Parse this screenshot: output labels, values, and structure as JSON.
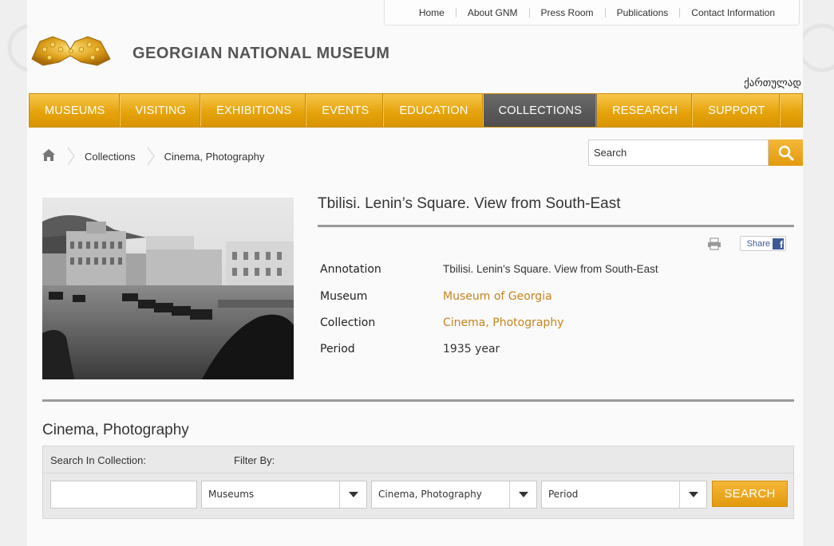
{
  "top_nav": [
    "Home",
    "About GNM",
    "Press Room",
    "Publications",
    "Contact Information"
  ],
  "site_title": "GEORGIAN NATIONAL MUSEUM",
  "language_link": "ქართულად",
  "main_nav": [
    {
      "label": "MUSEUMS",
      "active": false
    },
    {
      "label": "VISITING",
      "active": false
    },
    {
      "label": "EXHIBITIONS",
      "active": false
    },
    {
      "label": "EVENTS",
      "active": false
    },
    {
      "label": "EDUCATION",
      "active": false
    },
    {
      "label": "COLLECTIONS",
      "active": true
    },
    {
      "label": "RESEARCH",
      "active": false
    },
    {
      "label": "SUPPORT",
      "active": false
    }
  ],
  "breadcrumb": [
    "Collections",
    "Cinema, Photography"
  ],
  "search": {
    "value": "Search"
  },
  "item": {
    "title": "Tbilisi. Lenin’s Square. View from South-East",
    "share_label": "Share",
    "fields": [
      {
        "label": "Annotation",
        "value": "Tbilisi. Lenin’s Square. View from South-East"
      },
      {
        "label": "Museum",
        "value": "Museum of Georgia"
      },
      {
        "label": "Collection",
        "value": "Cinema, Photography"
      },
      {
        "label": "Period",
        "value": "1935 year"
      }
    ]
  },
  "section": {
    "title": "Cinema, Photography",
    "search_label": "Search In Collection:",
    "filter_label": "Filter By:",
    "input_value": "",
    "selects": [
      "Museums",
      "Cinema, Photography",
      "Period"
    ],
    "button_label": "SEARCH"
  },
  "colors": {
    "accent": "#e6a40c",
    "active_nav": "#555555",
    "link": "#c8831c"
  }
}
